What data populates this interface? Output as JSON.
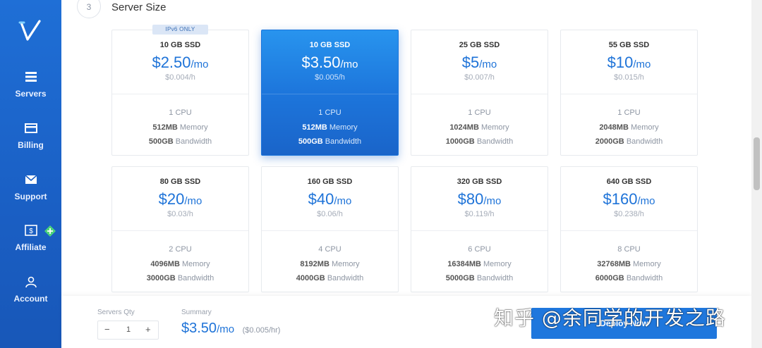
{
  "colors": {
    "sidebar": "#1a5fc4",
    "accent": "#1e73d8",
    "badge_bg": "#dbe6f6"
  },
  "sidebar": {
    "items": [
      {
        "label": "Servers",
        "icon": "servers-icon"
      },
      {
        "label": "Billing",
        "icon": "billing-icon"
      },
      {
        "label": "Support",
        "icon": "support-icon"
      },
      {
        "label": "Affiliate",
        "icon": "affiliate-icon"
      },
      {
        "label": "Account",
        "icon": "account-icon"
      }
    ]
  },
  "section": {
    "step": "3",
    "title": "Server Size"
  },
  "plans": [
    {
      "size": "10 GB SSD",
      "price": "$2.50",
      "per": "/mo",
      "hourly": "$0.004/h",
      "cpu": "1",
      "cpu_label": "CPU",
      "memory": "512MB",
      "memory_label": "Memory",
      "bandwidth": "500GB",
      "bandwidth_label": "Bandwidth",
      "badge": "IPv6 ONLY"
    },
    {
      "size": "10 GB SSD",
      "price": "$3.50",
      "per": "/mo",
      "hourly": "$0.005/h",
      "cpu": "1",
      "cpu_label": "CPU",
      "memory": "512MB",
      "memory_label": "Memory",
      "bandwidth": "500GB",
      "bandwidth_label": "Bandwidth",
      "selected": true
    },
    {
      "size": "25 GB SSD",
      "price": "$5",
      "per": "/mo",
      "hourly": "$0.007/h",
      "cpu": "1",
      "cpu_label": "CPU",
      "memory": "1024MB",
      "memory_label": "Memory",
      "bandwidth": "1000GB",
      "bandwidth_label": "Bandwidth"
    },
    {
      "size": "55 GB SSD",
      "price": "$10",
      "per": "/mo",
      "hourly": "$0.015/h",
      "cpu": "1",
      "cpu_label": "CPU",
      "memory": "2048MB",
      "memory_label": "Memory",
      "bandwidth": "2000GB",
      "bandwidth_label": "Bandwidth"
    },
    {
      "size": "80 GB SSD",
      "price": "$20",
      "per": "/mo",
      "hourly": "$0.03/h",
      "cpu": "2",
      "cpu_label": "CPU",
      "memory": "4096MB",
      "memory_label": "Memory",
      "bandwidth": "3000GB",
      "bandwidth_label": "Bandwidth"
    },
    {
      "size": "160 GB SSD",
      "price": "$40",
      "per": "/mo",
      "hourly": "$0.06/h",
      "cpu": "4",
      "cpu_label": "CPU",
      "memory": "8192MB",
      "memory_label": "Memory",
      "bandwidth": "4000GB",
      "bandwidth_label": "Bandwidth"
    },
    {
      "size": "320 GB SSD",
      "price": "$80",
      "per": "/mo",
      "hourly": "$0.119/h",
      "cpu": "6",
      "cpu_label": "CPU",
      "memory": "16384MB",
      "memory_label": "Memory",
      "bandwidth": "5000GB",
      "bandwidth_label": "Bandwidth"
    },
    {
      "size": "640 GB SSD",
      "price": "$160",
      "per": "/mo",
      "hourly": "$0.238/h",
      "cpu": "8",
      "cpu_label": "CPU",
      "memory": "32768MB",
      "memory_label": "Memory",
      "bandwidth": "6000GB",
      "bandwidth_label": "Bandwidth"
    }
  ],
  "footer": {
    "qty_label": "Servers Qty",
    "qty_minus": "−",
    "qty_value": "1",
    "qty_plus": "+",
    "summary_label": "Summary",
    "summary_price": "$3.50",
    "summary_per": "/mo",
    "summary_hourly": "($0.005/hr)",
    "deploy_label": "Deploy Now"
  },
  "watermark": "知乎 @余同学的开发之路"
}
